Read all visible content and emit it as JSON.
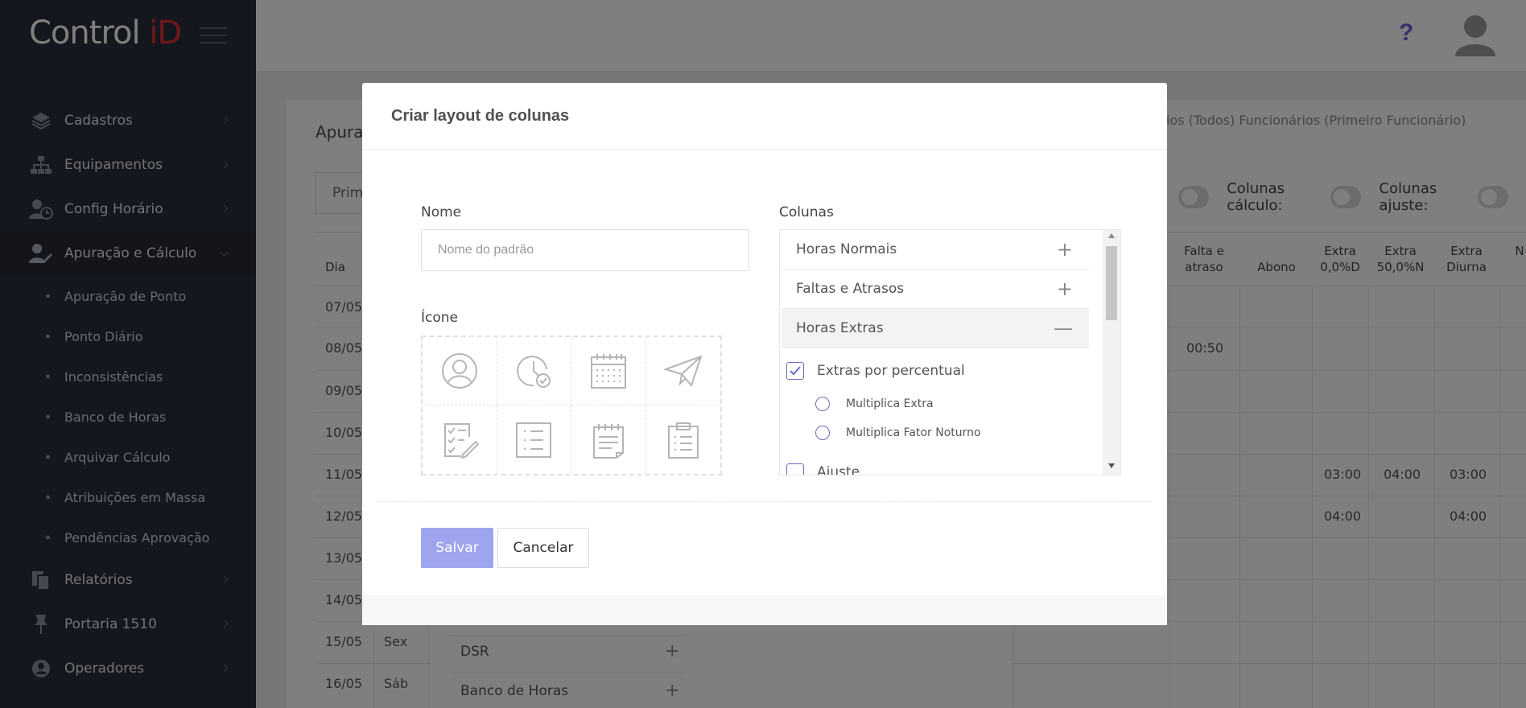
{
  "app": {
    "logo_text": "Control ",
    "logo_accent": "iD"
  },
  "sidebar": {
    "items": [
      {
        "label": "Cadastros",
        "icon": "layers-icon"
      },
      {
        "label": "Equipamentos",
        "icon": "sitemap-icon"
      },
      {
        "label": "Config Horário",
        "icon": "user-clock-icon"
      },
      {
        "label": "Apuração e Cálculo",
        "icon": "user-edit-icon"
      },
      {
        "label": "Relatórios",
        "icon": "copy-icon"
      },
      {
        "label": "Portaria 1510",
        "icon": "pin-icon"
      },
      {
        "label": "Operadores",
        "icon": "user-circle-icon"
      }
    ],
    "subitems": [
      {
        "label": "Apuração de Ponto"
      },
      {
        "label": "Ponto Diário"
      },
      {
        "label": "Inconsistências"
      },
      {
        "label": "Banco de Horas"
      },
      {
        "label": "Arquivar Cálculo"
      },
      {
        "label": "Atribuições em Massa"
      },
      {
        "label": "Pendências Aprovação"
      }
    ]
  },
  "topbar": {
    "help_symbol": "?"
  },
  "background": {
    "title": "Apuraç",
    "breadcrumbs": "rários (Todos)   Funcionários (Primeiro Funcionário)",
    "filter_text": "Prime",
    "toggle_calc_label": "Colunas cálculo:",
    "toggle_adjust_label": "Colunas ajuste:",
    "headers": [
      "Dia",
      "Falta e atraso",
      "Abono",
      "Extra 0,0%D",
      "Extra 50,0%N",
      "Extra Diurna",
      "N"
    ],
    "rows": [
      {
        "day": "07/05",
        "weekday": "",
        "falta": "",
        "e00": "",
        "e50": "",
        "ed": ""
      },
      {
        "day": "08/05",
        "weekday": "",
        "falta": "00:50",
        "e00": "",
        "e50": "",
        "ed": ""
      },
      {
        "day": "09/05",
        "weekday": "",
        "falta": "",
        "e00": "",
        "e50": "",
        "ed": ""
      },
      {
        "day": "10/05",
        "weekday": "",
        "falta": "",
        "e00": "",
        "e50": "",
        "ed": ""
      },
      {
        "day": "11/05",
        "weekday": "",
        "falta": "",
        "e00": "03:00",
        "e50": "04:00",
        "ed": "03:00"
      },
      {
        "day": "12/05",
        "weekday": "",
        "falta": "",
        "e00": "04:00",
        "e50": "",
        "ed": "04:00"
      },
      {
        "day": "13/05",
        "weekday": "",
        "falta": "",
        "e00": "",
        "e50": "",
        "ed": ""
      },
      {
        "day": "14/05",
        "weekday": "",
        "falta": "",
        "e00": "",
        "e50": "",
        "ed": ""
      },
      {
        "day": "15/05",
        "weekday": "Sex",
        "falta": "",
        "e00": "",
        "e50": "",
        "ed": ""
      },
      {
        "day": "16/05",
        "weekday": "Sáb",
        "falta": "",
        "e00": "",
        "e50": "",
        "ed": ""
      }
    ],
    "dropdown_items": [
      "DSR",
      "Banco de Horas"
    ]
  },
  "modal": {
    "title": "Criar layout de colunas",
    "name_label": "Nome",
    "name_placeholder": "Nome do padrão",
    "name_value": "",
    "icon_label": "Ícone",
    "icons": [
      "user-circle-icon",
      "clock-check-icon",
      "calendar-icon",
      "paper-plane-icon",
      "checklist-edit-icon",
      "list-icon",
      "notepad-icon",
      "clipboard-icon"
    ],
    "columns_label": "Colunas",
    "column_groups": [
      {
        "label": "Horas Normais",
        "sign": "+",
        "open": false
      },
      {
        "label": "Faltas e Atrasos",
        "sign": "+",
        "open": false
      },
      {
        "label": "Horas Extras",
        "sign": "—",
        "open": true
      }
    ],
    "extras_checkbox": {
      "label": "Extras por percentual",
      "checked": true
    },
    "extras_options": [
      {
        "label": "Multiplica Extra"
      },
      {
        "label": "Multiplica Fator Noturno"
      }
    ],
    "next_checkbox": {
      "label": "Ajuste",
      "checked": false
    },
    "save_label": "Salvar",
    "cancel_label": "Cancelar"
  },
  "colors": {
    "sidebar_bg": "#2b2f3e",
    "accent": "#6a6fbf",
    "save_button": "#9ea5ee",
    "logo_accent": "#e03131"
  }
}
